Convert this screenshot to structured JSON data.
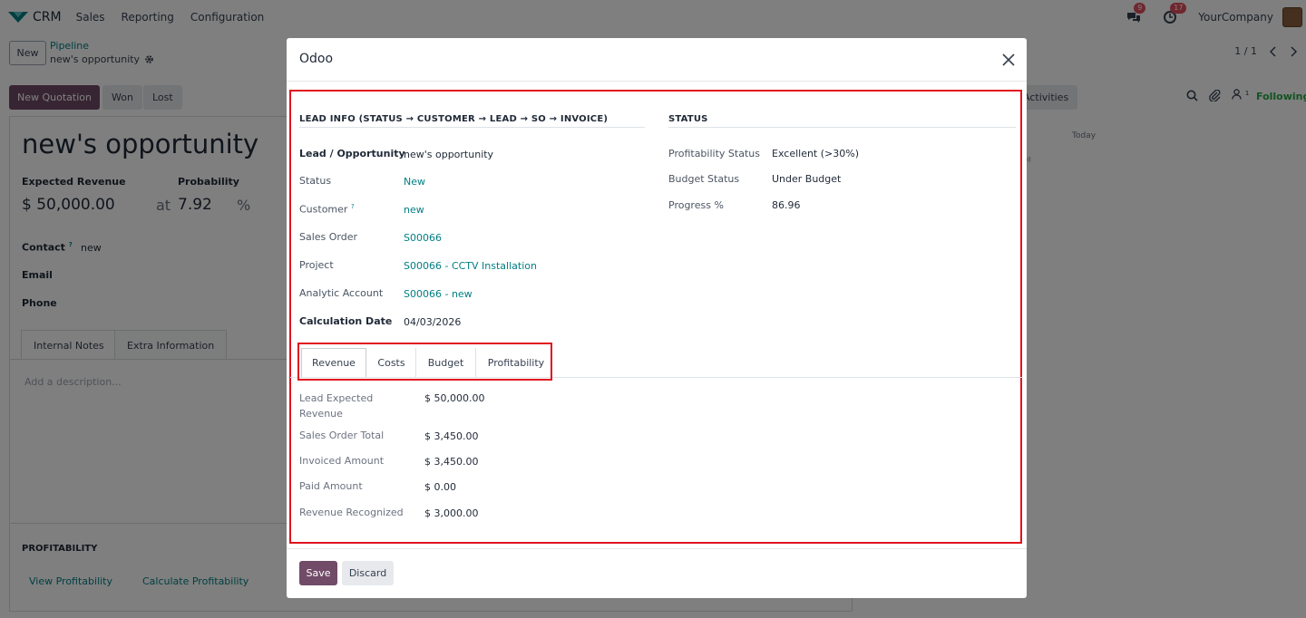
{
  "topnav": {
    "app_name": "CRM",
    "menu": [
      "Sales",
      "Reporting",
      "Configuration"
    ],
    "messages_count": "9",
    "activities_count": "17",
    "company": "YourCompany"
  },
  "control": {
    "new_label": "New",
    "breadcrumb": "Pipeline",
    "record_name": "new's opportunity",
    "pager": "1 / 1"
  },
  "statusbar": {
    "new_quotation": "New Quotation",
    "won": "Won",
    "lost": "Lost"
  },
  "form": {
    "title": "new's opportunity",
    "expected_revenue_label": "Expected Revenue",
    "expected_revenue": "$ 50,000.00",
    "probability_label": "Probability",
    "at": "at",
    "probability": "7.92",
    "percent": "%",
    "contact_label": "Contact",
    "contact_tip": "?",
    "contact_value": "new",
    "email_label": "Email",
    "phone_label": "Phone",
    "tabs": [
      "Internal Notes",
      "Extra Information"
    ],
    "description_placeholder": "Add a description...",
    "profitability_heading": "PROFITABILITY",
    "view_profitability": "View Profitability",
    "calculate_profitability": "Calculate Profitability"
  },
  "chatter": {
    "activities": "Activities",
    "followers_count": "1",
    "following": "Following",
    "today": "Today",
    "time_fragment": "M"
  },
  "modal": {
    "title": "Odoo",
    "lead_info_heading": "LEAD INFO (STATUS → CUSTOMER → LEAD → SO → INVOICE)",
    "status_heading": "STATUS",
    "fields": {
      "lead_label": "Lead / Opportunity",
      "lead_value": "new's opportunity",
      "status_label": "Status",
      "status_value": "New",
      "customer_label": "Customer",
      "customer_tip": "?",
      "customer_value": "new",
      "sales_order_label": "Sales Order",
      "sales_order_value": "S00066",
      "project_label": "Project",
      "project_value": "S00066 - CCTV Installation",
      "analytic_label": "Analytic Account",
      "analytic_value": "S00066 - new",
      "calc_date_label": "Calculation Date",
      "calc_date_value": "04/03/2026"
    },
    "status": {
      "profitability_label": "Profitability Status",
      "profitability_value": "Excellent (>30%)",
      "budget_label": "Budget Status",
      "budget_value": "Under Budget",
      "progress_label": "Progress %",
      "progress_value": "86.96"
    },
    "tabs": [
      "Revenue",
      "Costs",
      "Budget",
      "Profitability"
    ],
    "revenue": {
      "lead_expected_label_1": "Lead Expected",
      "lead_expected_label_2": "Revenue",
      "lead_expected_value": "$ 50,000.00",
      "so_total_label": "Sales Order Total",
      "so_total_value": "$ 3,450.00",
      "invoiced_label": "Invoiced Amount",
      "invoiced_value": "$ 3,450.00",
      "paid_label": "Paid Amount",
      "paid_value": "$ 0.00",
      "recognized_label": "Revenue Recognized",
      "recognized_value": "$ 3,000.00"
    },
    "save": "Save",
    "discard": "Discard"
  },
  "colors": {
    "brand": "#714b67",
    "link": "#017e84",
    "highlight": "#e0131f",
    "badge": "#e04d5c"
  }
}
